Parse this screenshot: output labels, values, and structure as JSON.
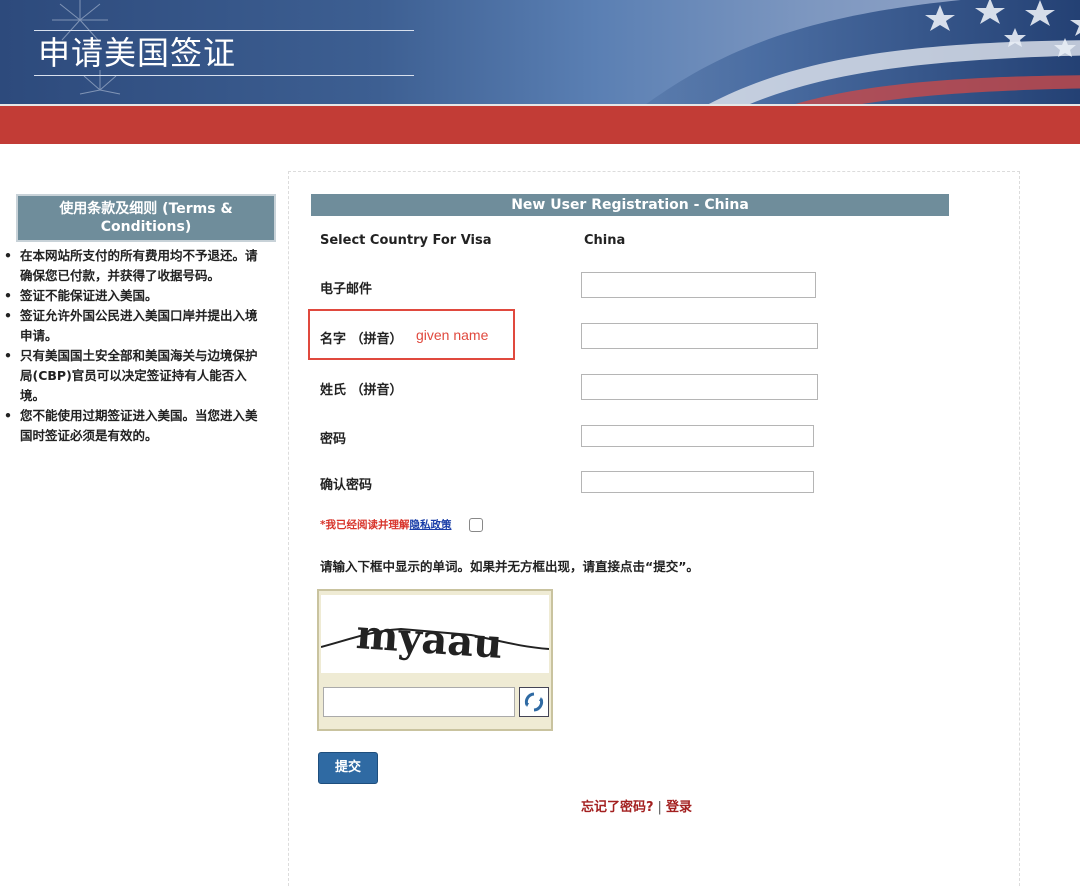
{
  "header": {
    "title": "申请美国签证"
  },
  "sidebar": {
    "heading": "使用条款及细则 (Terms & Conditions)",
    "items": [
      "在本网站所支付的所有费用均不予退还。请确保您已付款，并获得了收据号码。",
      "签证不能保证进入美国。",
      "签证允许外国公民进入美国口岸并提出入境申请。",
      "只有美国国土安全部和美国海关与边境保护局(CBP)官员可以决定签证持有人能否入境。",
      "您不能使用过期签证进入美国。当您进入美国时签证必须是有效的。"
    ]
  },
  "form": {
    "heading": "New User Registration - China",
    "country_label": "Select Country For Visa",
    "country_value": "China",
    "email_label": "电子邮件",
    "given_name_label": "名字 （拼音）",
    "given_name_annotation": "given name",
    "surname_label": "姓氏 （拼音）",
    "password_label": "密码",
    "confirm_password_label": "确认密码",
    "privacy_text": "*我已经阅读并理解",
    "privacy_link": "隐私政策",
    "captcha_instruction": "请输入下框中显示的单词。如果并无方框出现，请直接点击“提交”。",
    "captcha_word": "myaau",
    "submit_label": "提交",
    "forgot_password": "忘记了密码?",
    "separator": "|",
    "login": "登录"
  },
  "colors": {
    "header_bar": "#6f8d9b",
    "red_band": "#c23c36",
    "submit_button": "#2f6aa3",
    "annotation": "#e0493e"
  }
}
